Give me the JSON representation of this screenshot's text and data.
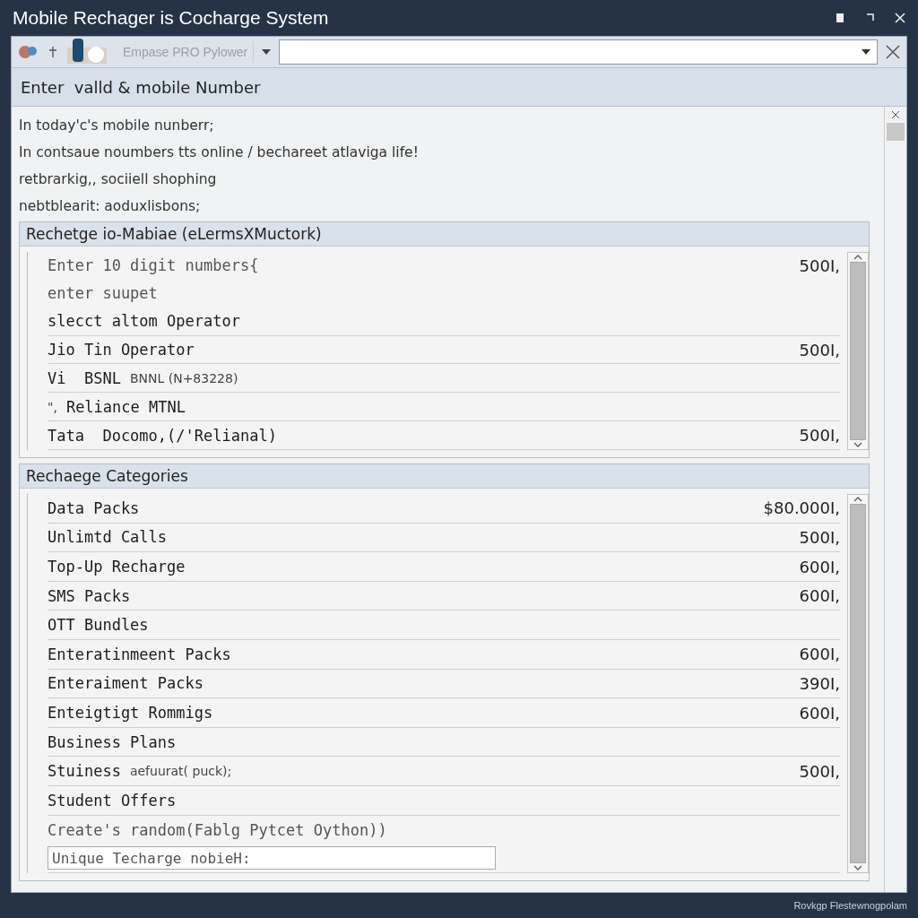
{
  "window": {
    "title": "Mobile Rechager is Cocharge System"
  },
  "toolbar": {
    "label": "Empase PRO Pylower"
  },
  "header": {
    "title": "Enter  valld & mobile Number"
  },
  "intro": [
    "In today'c's mobile nunberr;",
    "In contsaue noumbers tts online / bechareet atlaviga life!",
    "retbrarkig,, sociiell shophing",
    "nebtblearit: aoduxlisbons;"
  ],
  "operator_panel": {
    "title": "Rechetge io-Mabiae (eLermsXMuctork)",
    "rows": [
      {
        "kind": "hint",
        "label": "Enter 10 digit numbers{",
        "value": "500I,"
      },
      {
        "kind": "hint",
        "label": "enter suupet"
      },
      {
        "kind": "item",
        "label": "slecct altom Operator"
      },
      {
        "kind": "item",
        "label": "Jio Tin Operator",
        "value": "500I,"
      },
      {
        "kind": "item",
        "label": "Vi  BSNL",
        "note": "BNNL (N+83228)"
      },
      {
        "kind": "item",
        "prefix": "\",",
        "label": "Reliance MTNL"
      },
      {
        "kind": "item",
        "label": "Tata  Docomo,(/'Relianal)",
        "value": "500I,"
      }
    ]
  },
  "category_panel": {
    "title": "Rechaege Categories",
    "rows": [
      {
        "kind": "item",
        "label": "Data Packs",
        "value": "$80.000I,"
      },
      {
        "kind": "item",
        "label": "Unlimtd Calls",
        "value": "500I,"
      },
      {
        "kind": "item",
        "label": "Top-Up Recharge",
        "value": "600I,"
      },
      {
        "kind": "item",
        "label": "SMS Packs",
        "value": "600I,"
      },
      {
        "kind": "item",
        "label": "OTT Bundles"
      },
      {
        "kind": "item",
        "label": "Enteratinmeent Packs",
        "value": "600I,"
      },
      {
        "kind": "item",
        "label": "Enteraiment Packs",
        "value": "390I,"
      },
      {
        "kind": "item",
        "label": "Enteigtigt Rommigs",
        "value": "600I,"
      },
      {
        "kind": "item",
        "label": "Business Plans"
      },
      {
        "kind": "item",
        "label": "Stuiness",
        "note": "aefuurat( puck);",
        "value": "500I,"
      },
      {
        "kind": "item",
        "label": "Student Offers"
      },
      {
        "kind": "hint",
        "label": "Create's random(Fablg Pytcet Oython))"
      },
      {
        "kind": "input",
        "label": "Unique Techarge nobieH:"
      }
    ]
  },
  "status_bar": {
    "text": "Rovkgp Flestewnogpolam"
  }
}
